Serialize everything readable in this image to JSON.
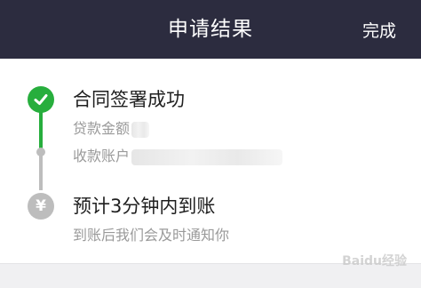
{
  "header": {
    "title": "申请结果",
    "done_label": "完成"
  },
  "steps": [
    {
      "status": "success",
      "icon": "check-icon",
      "title": "合同签署成功",
      "lines": [
        "贷款金额",
        "收款账户"
      ]
    },
    {
      "status": "pending",
      "icon": "yuan-icon",
      "icon_glyph": "¥",
      "title": "预计3分钟内到账",
      "lines": [
        "到账后我们会及时通知你"
      ]
    }
  ],
  "watermark": "Baidu经验",
  "colors": {
    "header_bg": "#2c2c3f",
    "success": "#27ae3d",
    "pending": "#bdbdbd",
    "secondary_text": "#9a9a9a"
  }
}
